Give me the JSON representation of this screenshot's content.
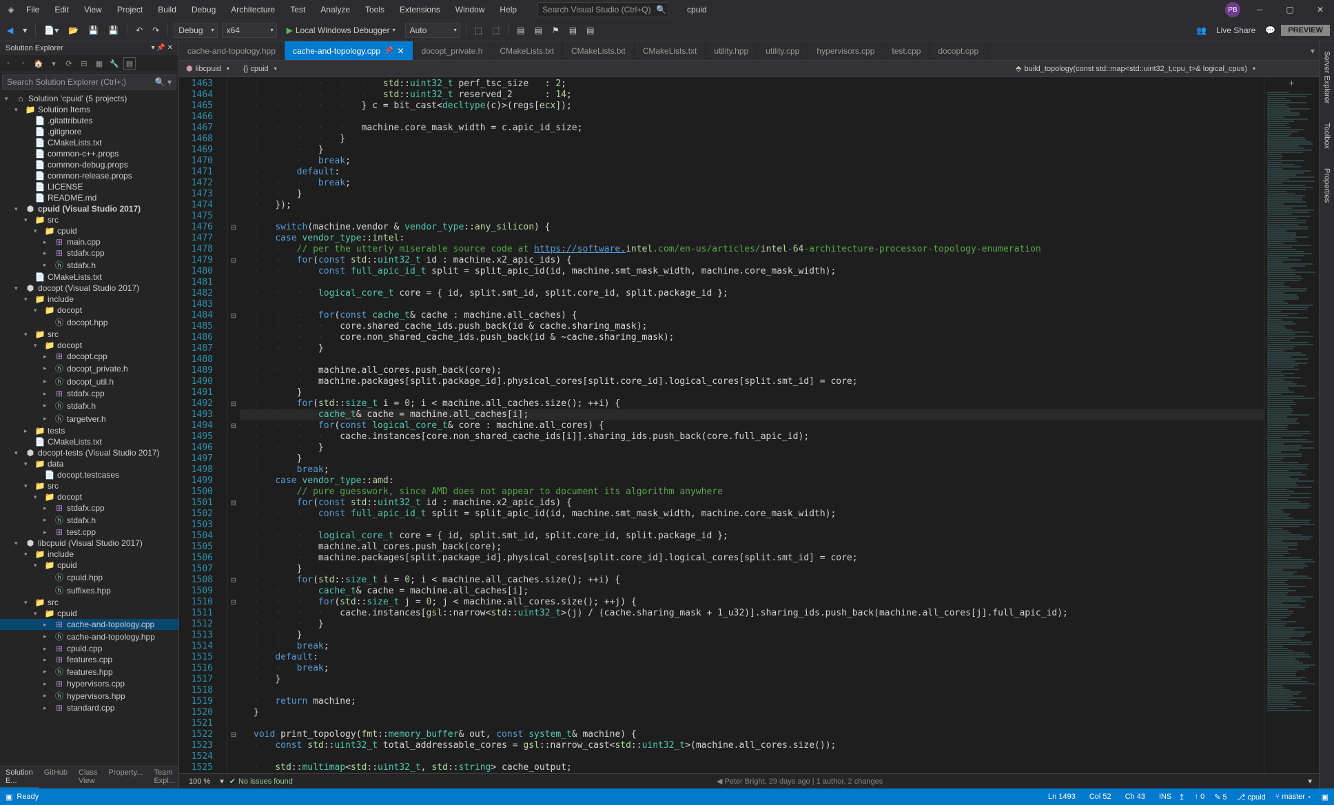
{
  "title_bar": {
    "solution_name": "cpuid",
    "user_initials": "PB"
  },
  "menu": [
    "File",
    "Edit",
    "View",
    "Project",
    "Build",
    "Debug",
    "Architecture",
    "Test",
    "Analyze",
    "Tools",
    "Extensions",
    "Window",
    "Help"
  ],
  "search_placeholder": "Search Visual Studio (Ctrl+Q)",
  "toolbar": {
    "config": "Debug",
    "platform": "x64",
    "run_label": "Local Windows Debugger",
    "run_config": "Auto",
    "live_share": "Live Share",
    "preview": "PREVIEW"
  },
  "solution_explorer": {
    "title": "Solution Explorer",
    "search_placeholder": "Search Solution Explorer (Ctrl+;)",
    "tree": [
      {
        "d": 0,
        "a": "▾",
        "i": "⌂",
        "l": "Solution 'cpuid' (5 projects)"
      },
      {
        "d": 1,
        "a": "▾",
        "i": "📁",
        "l": "Solution Items"
      },
      {
        "d": 2,
        "a": "",
        "i": "📄",
        "l": ".gitattributes"
      },
      {
        "d": 2,
        "a": "",
        "i": "📄",
        "l": ".gitignore"
      },
      {
        "d": 2,
        "a": "",
        "i": "📄",
        "l": "CMakeLists.txt"
      },
      {
        "d": 2,
        "a": "",
        "i": "📄",
        "l": "common-c++.props"
      },
      {
        "d": 2,
        "a": "",
        "i": "📄",
        "l": "common-debug.props"
      },
      {
        "d": 2,
        "a": "",
        "i": "📄",
        "l": "common-release.props"
      },
      {
        "d": 2,
        "a": "",
        "i": "📄",
        "l": "LICENSE"
      },
      {
        "d": 2,
        "a": "",
        "i": "📄",
        "l": "README.md"
      },
      {
        "d": 1,
        "a": "▾",
        "i": "⬢",
        "l": "cpuid (Visual Studio 2017)",
        "b": true
      },
      {
        "d": 2,
        "a": "▾",
        "i": "📁",
        "l": "src"
      },
      {
        "d": 3,
        "a": "▾",
        "i": "📁",
        "l": "cpuid"
      },
      {
        "d": 4,
        "a": "▸",
        "i": "++",
        "l": "main.cpp"
      },
      {
        "d": 4,
        "a": "▸",
        "i": "++",
        "l": "stdafx.cpp"
      },
      {
        "d": 4,
        "a": "▸",
        "i": "h",
        "l": "stdafx.h"
      },
      {
        "d": 2,
        "a": "",
        "i": "📄",
        "l": "CMakeLists.txt"
      },
      {
        "d": 1,
        "a": "▾",
        "i": "⬢",
        "l": "docopt (Visual Studio 2017)"
      },
      {
        "d": 2,
        "a": "▾",
        "i": "📁",
        "l": "include"
      },
      {
        "d": 3,
        "a": "▾",
        "i": "📁",
        "l": "docopt"
      },
      {
        "d": 4,
        "a": "",
        "i": "h",
        "l": "docopt.hpp"
      },
      {
        "d": 2,
        "a": "▾",
        "i": "📁",
        "l": "src"
      },
      {
        "d": 3,
        "a": "▾",
        "i": "📁",
        "l": "docopt"
      },
      {
        "d": 4,
        "a": "▸",
        "i": "++",
        "l": "docopt.cpp"
      },
      {
        "d": 4,
        "a": "▸",
        "i": "h",
        "l": "docopt_private.h"
      },
      {
        "d": 4,
        "a": "▸",
        "i": "h",
        "l": "docopt_util.h"
      },
      {
        "d": 4,
        "a": "▸",
        "i": "++",
        "l": "stdafx.cpp"
      },
      {
        "d": 4,
        "a": "▸",
        "i": "h",
        "l": "stdafx.h"
      },
      {
        "d": 4,
        "a": "▸",
        "i": "h",
        "l": "targetver.h"
      },
      {
        "d": 2,
        "a": "▸",
        "i": "📁",
        "l": "tests"
      },
      {
        "d": 2,
        "a": "",
        "i": "📄",
        "l": "CMakeLists.txt"
      },
      {
        "d": 1,
        "a": "▾",
        "i": "⬢",
        "l": "docopt-tests (Visual Studio 2017)"
      },
      {
        "d": 2,
        "a": "▾",
        "i": "📁",
        "l": "data"
      },
      {
        "d": 3,
        "a": "",
        "i": "📄",
        "l": "docopt.testcases"
      },
      {
        "d": 2,
        "a": "▾",
        "i": "📁",
        "l": "src"
      },
      {
        "d": 3,
        "a": "▾",
        "i": "📁",
        "l": "docopt"
      },
      {
        "d": 4,
        "a": "▸",
        "i": "++",
        "l": "stdafx.cpp"
      },
      {
        "d": 4,
        "a": "▸",
        "i": "h",
        "l": "stdafx.h"
      },
      {
        "d": 4,
        "a": "▸",
        "i": "++",
        "l": "test.cpp"
      },
      {
        "d": 1,
        "a": "▾",
        "i": "⬢",
        "l": "libcpuid (Visual Studio 2017)"
      },
      {
        "d": 2,
        "a": "▾",
        "i": "📁",
        "l": "include"
      },
      {
        "d": 3,
        "a": "▾",
        "i": "📁",
        "l": "cpuid"
      },
      {
        "d": 4,
        "a": "",
        "i": "h",
        "l": "cpuid.hpp"
      },
      {
        "d": 4,
        "a": "",
        "i": "h",
        "l": "suffixes.hpp"
      },
      {
        "d": 2,
        "a": "▾",
        "i": "📁",
        "l": "src"
      },
      {
        "d": 3,
        "a": "▾",
        "i": "📁",
        "l": "cpuid"
      },
      {
        "d": 4,
        "a": "▸",
        "i": "++",
        "l": "cache-and-topology.cpp",
        "hl": true
      },
      {
        "d": 4,
        "a": "▸",
        "i": "h",
        "l": "cache-and-topology.hpp"
      },
      {
        "d": 4,
        "a": "▸",
        "i": "++",
        "l": "cpuid.cpp"
      },
      {
        "d": 4,
        "a": "▸",
        "i": "++",
        "l": "features.cpp"
      },
      {
        "d": 4,
        "a": "▸",
        "i": "h",
        "l": "features.hpp"
      },
      {
        "d": 4,
        "a": "▸",
        "i": "++",
        "l": "hypervisors.cpp"
      },
      {
        "d": 4,
        "a": "▸",
        "i": "h",
        "l": "hypervisors.hpp"
      },
      {
        "d": 4,
        "a": "▸",
        "i": "++",
        "l": "standard.cpp"
      }
    ],
    "bottom_tabs": [
      "Solution E...",
      "GitHub",
      "Class View",
      "Property...",
      "Team Expl..."
    ]
  },
  "tabs": [
    {
      "label": "cache-and-topology.hpp"
    },
    {
      "label": "cache-and-topology.cpp",
      "active": true,
      "pinned": true,
      "close": true
    },
    {
      "label": "docopt_private.h"
    },
    {
      "label": "CMakeLists.txt"
    },
    {
      "label": "CMakeLists.txt"
    },
    {
      "label": "CMakeLists.txt"
    },
    {
      "label": "utility.hpp"
    },
    {
      "label": "utility.cpp"
    },
    {
      "label": "hypervisors.cpp"
    },
    {
      "label": "test.cpp"
    },
    {
      "label": "docopt.cpp"
    }
  ],
  "nav": {
    "project": "libcpuid",
    "scope": "{} cpuid",
    "member": "build_topology(const std::map<std::uint32_t,cpu_t>& logical_cpus)"
  },
  "code": {
    "first_line": 1463,
    "current_line": 1493,
    "lines": [
      "                        std::uint32_t perf_tsc_size   : 2;",
      "                        std::uint32_t reserved_2      : 14;",
      "                    } c = bit_cast<decltype(c)>(regs[ecx]);",
      "",
      "                    machine.core_mask_width = c.apic_id_size;",
      "                }",
      "            }",
      "            break;",
      "        default:",
      "            break;",
      "        }",
      "    });",
      "",
      "    switch(machine.vendor & vendor_type::any_silicon) {",
      "    case vendor_type::intel:",
      "        // per the utterly miserable source code at https://software.intel.com/en-us/articles/intel-64-architecture-processor-topology-enumeration",
      "        for(const std::uint32_t id : machine.x2_apic_ids) {",
      "            const full_apic_id_t split = split_apic_id(id, machine.smt_mask_width, machine.core_mask_width);",
      "",
      "            logical_core_t core = { id, split.smt_id, split.core_id, split.package_id };",
      "",
      "            for(const cache_t& cache : machine.all_caches) {",
      "                core.shared_cache_ids.push_back(id & cache.sharing_mask);",
      "                core.non_shared_cache_ids.push_back(id & ~cache.sharing_mask);",
      "            }",
      "",
      "            machine.all_cores.push_back(core);",
      "            machine.packages[split.package_id].physical_cores[split.core_id].logical_cores[split.smt_id] = core;",
      "        }",
      "        for(std::size_t i = 0; i < machine.all_caches.size(); ++i) {",
      "            cache_t& cache = machine.all_caches[i];",
      "            for(const logical_core_t& core : machine.all_cores) {",
      "                cache.instances[core.non_shared_cache_ids[i]].sharing_ids.push_back(core.full_apic_id);",
      "            }",
      "        }",
      "        break;",
      "    case vendor_type::amd:",
      "        // pure guesswork, since AMD does not appear to document its algorithm anywhere",
      "        for(const std::uint32_t id : machine.x2_apic_ids) {",
      "            const full_apic_id_t split = split_apic_id(id, machine.smt_mask_width, machine.core_mask_width);",
      "",
      "            logical_core_t core = { id, split.smt_id, split.core_id, split.package_id };",
      "            machine.all_cores.push_back(core);",
      "            machine.packages[split.package_id].physical_cores[split.core_id].logical_cores[split.smt_id] = core;",
      "        }",
      "        for(std::size_t i = 0; i < machine.all_caches.size(); ++i) {",
      "            cache_t& cache = machine.all_caches[i];",
      "            for(std::size_t j = 0; j < machine.all_cores.size(); ++j) {",
      "                cache.instances[gsl::narrow<std::uint32_t>(j) / (cache.sharing_mask + 1_u32)].sharing_ids.push_back(machine.all_cores[j].full_apic_id);",
      "            }",
      "        }",
      "        break;",
      "    default:",
      "        break;",
      "    }",
      "",
      "    return machine;",
      "}",
      "",
      "void print_topology(fmt::memory_buffer& out, const system_t& machine) {",
      "    const std::uint32_t total_addressable_cores = gsl::narrow_cast<std::uint32_t>(machine.all_cores.size());",
      "",
      "    std::multimap<std::uint32_t, std::string> cache_output;"
    ]
  },
  "bottom_status": {
    "zoom": "100 %",
    "issues": "No issues found",
    "blame": "Peter Bright, 29 days ago | 1 author, 2 changes"
  },
  "status_bar": {
    "ready": "Ready",
    "ln": "Ln 1493",
    "col": "Col 52",
    "ch": "Ch 43",
    "ins": "INS",
    "arrows_up": "0",
    "arrows_down": "5",
    "repo": "cpuid",
    "branch": "master"
  },
  "right_rail": [
    "Server Explorer",
    "Toolbox",
    "Properties"
  ]
}
